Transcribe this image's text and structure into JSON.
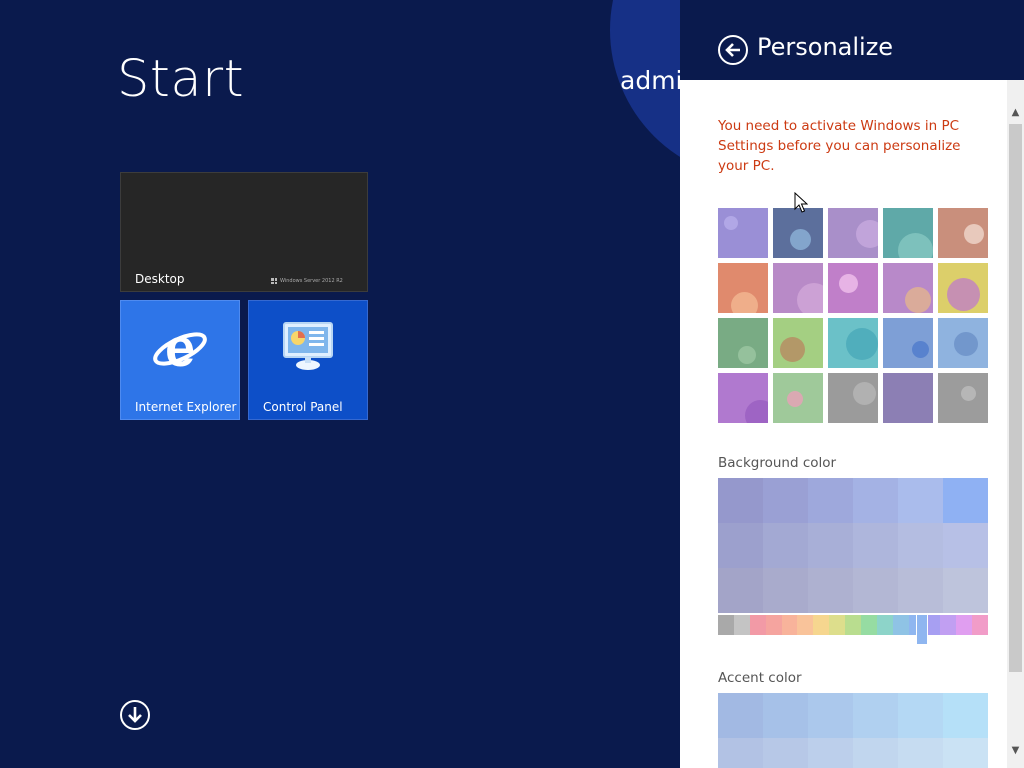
{
  "start": {
    "title": "Start",
    "user_name": "administrator",
    "tiles": {
      "desktop": {
        "label": "Desktop",
        "brand": "Windows Server 2012 R2"
      },
      "ie": {
        "label": "Internet Explorer"
      },
      "control_panel": {
        "label": "Control Panel"
      }
    },
    "icons": {
      "apps_arrow": "down-arrow-circle-icon",
      "ie": "internet-explorer-icon",
      "control_panel": "control-panel-icon"
    }
  },
  "personalize": {
    "title": "Personalize",
    "back_icon": "back-arrow-icon",
    "warning": "You need to activate Windows in PC Settings before you can personalize your PC.",
    "patterns": [
      {
        "bg": "#9a8fd6",
        "accent": "#b6acea"
      },
      {
        "bg": "#5c6f9c",
        "accent": "#8db3d8"
      },
      {
        "bg": "#a98fc9",
        "accent": "#c7a9df"
      },
      {
        "bg": "#5fa9a8",
        "accent": "#85c7c1"
      },
      {
        "bg": "#c98f7c",
        "accent": "#f0d7cc"
      },
      {
        "bg": "#e08a6d",
        "accent": "#f3b691"
      },
      {
        "bg": "#b88ac7",
        "accent": "#d1a6d8"
      },
      {
        "bg": "#c07fc9",
        "accent": "#f0c1ec"
      },
      {
        "bg": "#b889c9",
        "accent": "#e2b48e"
      },
      {
        "bg": "#dccf6a",
        "accent": "#c07fc4"
      },
      {
        "bg": "#79ab84",
        "accent": "#9cc7a3"
      },
      {
        "bg": "#a4cf82",
        "accent": "#b78a62"
      },
      {
        "bg": "#6bc1c8",
        "accent": "#4aa9b9"
      },
      {
        "bg": "#7e9fd6",
        "accent": "#4f7bcc"
      },
      {
        "bg": "#8fb3df",
        "accent": "#6a90c7"
      },
      {
        "bg": "#b079cf",
        "accent": "#9a5fc1"
      },
      {
        "bg": "#9fc99a",
        "accent": "#e8a1b8"
      },
      {
        "bg": "#9b9b9b",
        "accent": "#b7b7b7"
      },
      {
        "bg": "#8c7fb4",
        "accent": "#8c7fb4"
      },
      {
        "bg": "#9c9c9c",
        "accent": "#bdbdbd"
      }
    ],
    "background_color_label": "Background color",
    "background_colors": [
      "#9598cc",
      "#9aa0d4",
      "#9ea8dc",
      "#a4b2e4",
      "#aabcec",
      "#8fb1f3",
      "#9ca0cd",
      "#a3a9d3",
      "#a8afd7",
      "#aeb6dc",
      "#b4bde1",
      "#b7c0e6",
      "#a3a4c8",
      "#a9abcc",
      "#aeb1d0",
      "#b3b7d4",
      "#b8bdd8",
      "#bec4dc"
    ],
    "hue_colors": [
      "#a9a9a9",
      "#c4c4c4",
      "#f29aa6",
      "#f5a49f",
      "#f8b39b",
      "#f9c39a",
      "#f6d68f",
      "#ddde8c",
      "#b9dd8f",
      "#96dca2",
      "#8dd4c9",
      "#8fc3e5",
      "#8fb6f0",
      "#a79ff2",
      "#c19ff2",
      "#e09ef0",
      "#f19cc8"
    ],
    "hue_value": 0.755,
    "accent_color_label": "Accent color",
    "accent_colors": [
      "#a2b9e3",
      "#a6c1e8",
      "#abc8ec",
      "#b0d0f0",
      "#b4d8f4",
      "#b5e0f8",
      "#b2c2e4",
      "#b7c8e7",
      "#bccfeb",
      "#c1d6ee",
      "#c6dcf1",
      "#cae2f4"
    ],
    "scroll_up_icon": "scroll-up-icon",
    "scroll_down_icon": "scroll-down-icon"
  }
}
